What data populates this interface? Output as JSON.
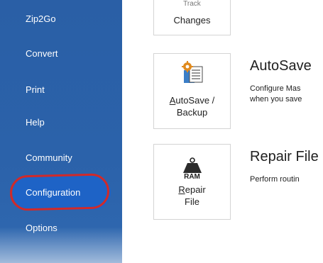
{
  "sidebar": {
    "items": [
      {
        "label": "Zip2Go"
      },
      {
        "label": "Convert"
      },
      {
        "label": "Print"
      },
      {
        "label": "Help"
      },
      {
        "label": "Community"
      },
      {
        "label": "Configuration",
        "selected": true
      },
      {
        "label": "Options"
      }
    ],
    "accent": "#2a5fa6",
    "selected_color": "#1e63c6",
    "highlight_ring_color": "#d02a2a"
  },
  "tiles": {
    "track_changes": {
      "label_top": "Track",
      "label": "Changes"
    },
    "autosave": {
      "label_line1_mnemonic": "A",
      "label_line1_rest": "utoSave /",
      "label_line2": "Backup",
      "icon": "gear-document-icon"
    },
    "repair": {
      "icon_text": "RAM",
      "label_line1_mnemonic": "R",
      "label_line1_rest": "epair",
      "label_line2": "File",
      "icon": "weight-ram-icon"
    }
  },
  "features": {
    "autosave": {
      "title": "AutoSave",
      "desc_line1": "Configure Mas",
      "desc_line2": "when you save"
    },
    "repair": {
      "title": "Repair File",
      "desc_line1": "Perform routin"
    }
  }
}
